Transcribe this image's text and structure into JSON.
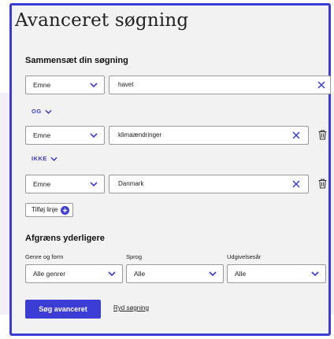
{
  "page": {
    "title": "Avanceret søgning"
  },
  "compose": {
    "heading": "Sammensæt din søgning",
    "rows": [
      {
        "field": "Emne",
        "value": "havet"
      },
      {
        "field": "Emne",
        "value": "klimaændringer"
      },
      {
        "field": "Emne",
        "value": "Danmark"
      }
    ],
    "operators": [
      "OG",
      "IKKE"
    ],
    "add_line_label": "Tilføj linje"
  },
  "refine": {
    "heading": "Afgræns yderligere",
    "filters": [
      {
        "label": "Genre og form",
        "value": "Alle genrer"
      },
      {
        "label": "Sprog",
        "value": "Alle"
      },
      {
        "label": "Udgivelsesår",
        "value": "Alle"
      }
    ]
  },
  "actions": {
    "search_label": "Søg avanceret",
    "clear_label": "Ryd søgning"
  },
  "colors": {
    "accent": "#3c3cd7",
    "panel_bg": "#f2f2f2",
    "page_bg": "#f4eefa"
  },
  "icons": {
    "chevron": "chevron-down-icon",
    "clear": "close-icon",
    "delete": "trash-icon",
    "add": "plus-circle-icon"
  }
}
